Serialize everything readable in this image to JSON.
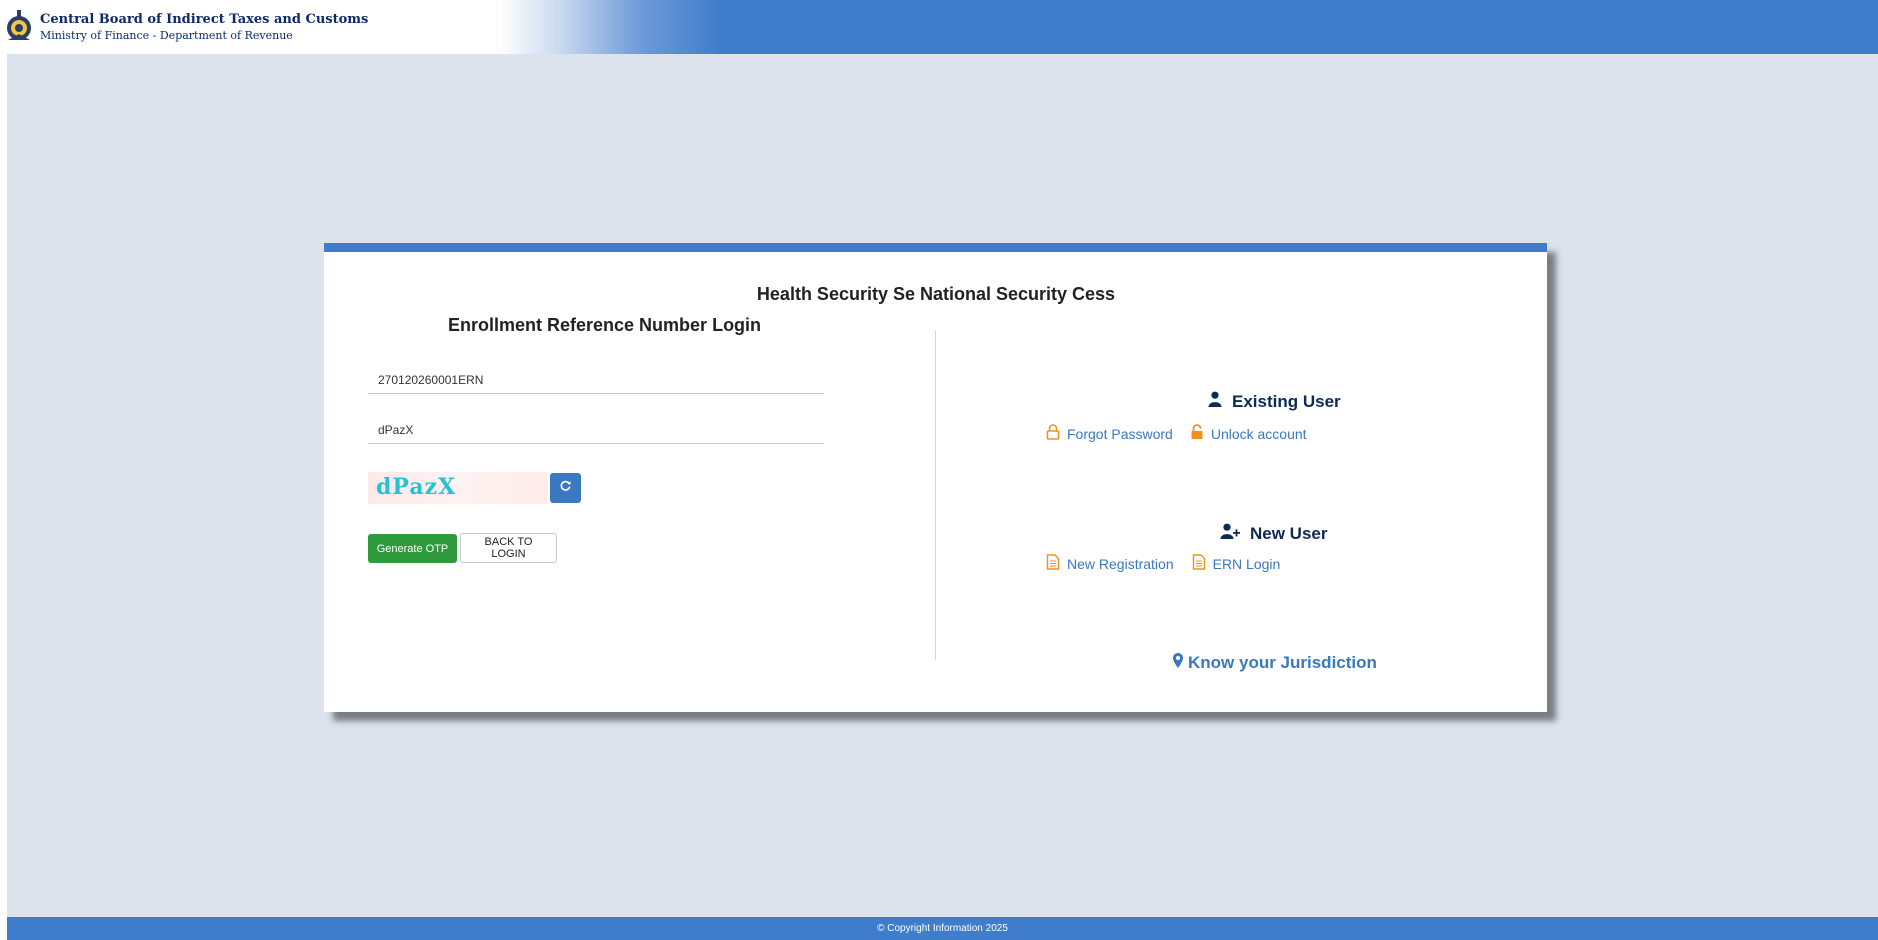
{
  "header": {
    "org_name": "Central Board of Indirect Taxes and Customs",
    "org_sub": "Ministry of Finance - Department of Revenue",
    "emblem_icon": "emblem-icon"
  },
  "card": {
    "title": "Health Security Se National Security Cess",
    "login": {
      "title": "Enrollment Reference Number Login",
      "ern_value": "270120260001ERN",
      "captcha_input_value": "dPazX",
      "captcha_image_text": "dPazX",
      "generate_otp_label": "Generate OTP",
      "back_to_login_label": "BACK TO LOGIN"
    },
    "existing_user": {
      "title": "Existing User",
      "forgot_password": "Forgot Password",
      "unlock_account": "Unlock account"
    },
    "new_user": {
      "title": "New User",
      "new_registration": "New Registration",
      "ern_login": "ERN Login"
    },
    "jurisdiction": "Know your Jurisdiction"
  },
  "footer": {
    "copyright": "© Copyright Information 2025"
  },
  "colors": {
    "accent": "#3f7dcc",
    "link": "#3a78bf",
    "icon_orange": "#f0911f",
    "otp_green": "#2e9a3c",
    "heading_navy": "#0d2a55"
  }
}
